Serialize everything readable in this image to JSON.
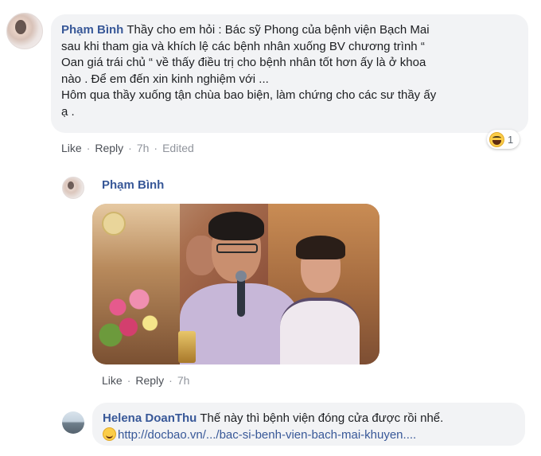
{
  "comment1": {
    "author": "Phạm Bình",
    "lines": [
      "Thầy cho em hỏi : Bác sỹ Phong của bệnh viện Bạch Mai",
      "sau khi tham gia và khích lệ các bệnh nhân xuống BV chương trình “",
      "Oan giá trái chủ “ về thấy điều trị cho bệnh nhân tốt hơn ấy là ở khoa",
      "nào . Để em đến xin kinh nghiệm với ...",
      "Hôm qua thầy xuống tận chùa bao biện, làm chứng cho các sư thầy ấy",
      "ạ ."
    ],
    "actions": {
      "like": "Like",
      "reply": "Reply",
      "time": "7h",
      "edited": "Edited"
    },
    "reaction": {
      "icon": "haha-icon",
      "count": "1"
    }
  },
  "comment2": {
    "author": "Phạm Bình",
    "actions": {
      "like": "Like",
      "reply": "Reply",
      "time": "7h"
    }
  },
  "comment3": {
    "author": "Helena DoanThu",
    "text": "Thế này thì bệnh viện đóng cửa được rồi nhể.",
    "link": "http://docbao.vn/.../bac-si-benh-vien-bach-mai-khuyen...."
  },
  "separator": "·"
}
